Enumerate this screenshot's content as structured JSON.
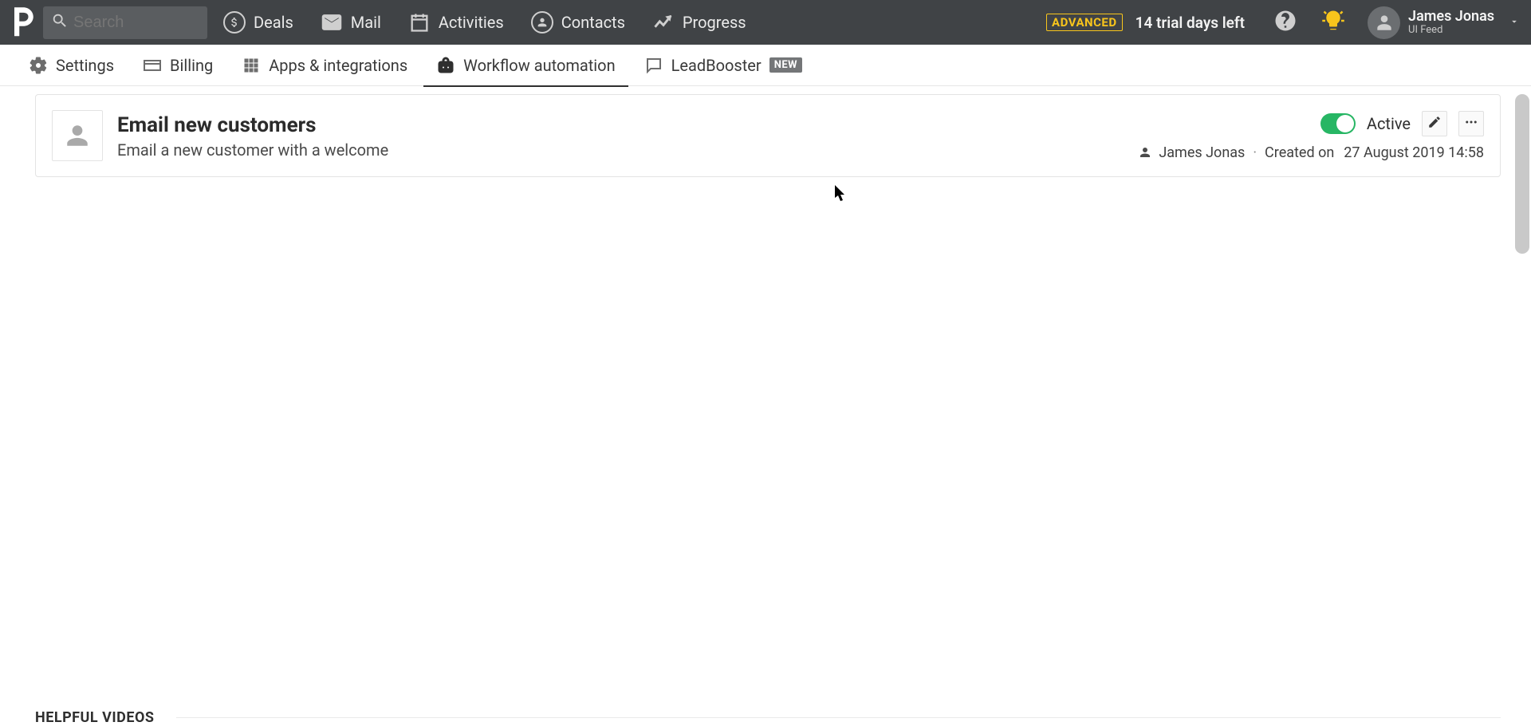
{
  "header": {
    "search_placeholder": "Search",
    "nav": {
      "deals": "Deals",
      "mail": "Mail",
      "activities": "Activities",
      "contacts": "Contacts",
      "progress": "Progress"
    },
    "plan_badge": "ADVANCED",
    "trial_text": "14 trial days left",
    "user": {
      "name": "James Jonas",
      "sub": "UI Feed"
    }
  },
  "tabs": {
    "settings": "Settings",
    "billing": "Billing",
    "apps": "Apps & integrations",
    "workflow": "Workflow automation",
    "leadbooster": "LeadBooster",
    "leadbooster_badge": "NEW"
  },
  "workflow": {
    "title": "Email new customers",
    "description": "Email a new customer with a welcome",
    "status_label": "Active",
    "owner": "James Jonas",
    "created_label": "Created on",
    "created_date": "27 August 2019 14:58"
  },
  "sections": {
    "helpful_videos": "HELPFUL VIDEOS"
  }
}
